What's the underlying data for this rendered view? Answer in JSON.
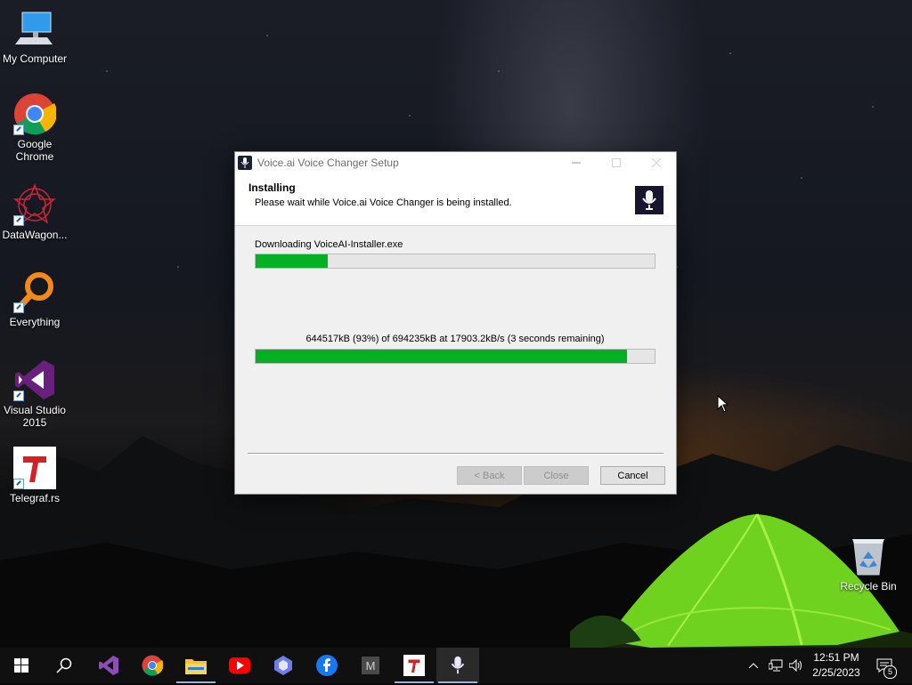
{
  "desktop": {
    "icons": [
      {
        "label": "My Computer"
      },
      {
        "label": "Google Chrome"
      },
      {
        "label": "DataWagon..."
      },
      {
        "label": "Everything"
      },
      {
        "label": "Visual Studio 2015"
      },
      {
        "label": "Telegraf.rs"
      }
    ],
    "recycle_bin": {
      "label": "Recycle Bin"
    }
  },
  "dialog": {
    "title": "Voice.ai Voice Changer Setup",
    "header_title": "Installing",
    "header_subtitle": "Please wait while Voice.ai Voice Changer is being installed.",
    "download_label": "Downloading VoiceAI-Installer.exe",
    "overall_progress_fraction": 0.18,
    "status_text": "644517kB (93%) of 694235kB at 17903.2kB/s (3 seconds remaining)",
    "download_progress_fraction": 0.93,
    "buttons": {
      "back": "< Back",
      "close": "Close",
      "cancel": "Cancel"
    }
  },
  "taskbar": {
    "items": [
      "start-icon",
      "search-icon",
      "visual-studio-icon",
      "chrome-icon",
      "file-explorer-icon",
      "youtube-icon",
      "copilot-icon",
      "facebook-icon",
      "m-app-icon",
      "telegraf-icon",
      "voice-ai-icon"
    ],
    "clock": {
      "time": "12:51 PM",
      "date": "2/25/2023"
    },
    "notification_count": "5"
  },
  "colors": {
    "progress_green": "#06b025",
    "taskbar": "#101010"
  }
}
